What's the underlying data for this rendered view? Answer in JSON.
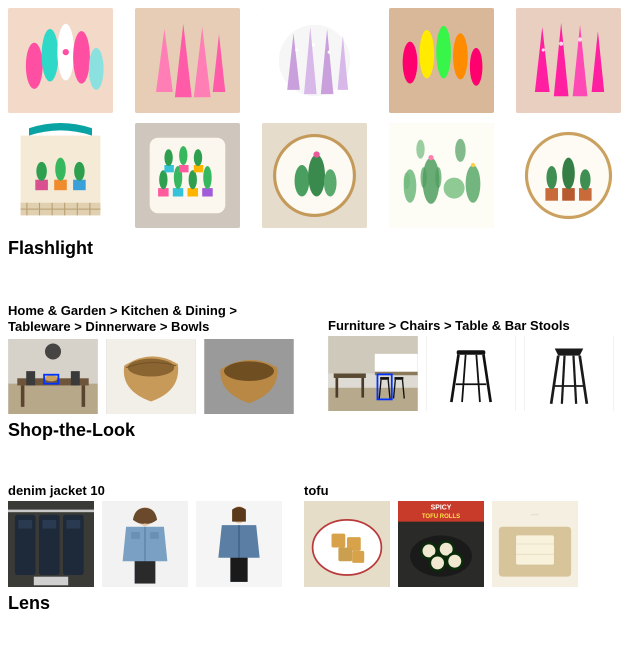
{
  "sections": {
    "flashlight": {
      "heading": "Flashlight",
      "rows": [
        {
          "query_desc": "hand with colorful stiletto nails (pink/teal/art)",
          "results_desc": [
            "pointed pink ombre stiletto nails",
            "glitter chrome stiletto nails",
            "neon multicolor almond nails (pink/yellow/green/orange)",
            "hot pink glitter stiletto nails"
          ]
        },
        {
          "query_desc": "cactus embroidery on jute tote bag",
          "results_desc": [
            "cushion with colorful potted cacti print",
            "embroidery hoop with three green cacti",
            "watercolor cactus illustration set",
            "embroidery hoop with three potted cacti (terracotta pots)"
          ]
        }
      ]
    },
    "shop_the_look": {
      "heading": "Shop-the-Look",
      "groups": [
        {
          "breadcrumb": "Home & Garden > Kitchen & Dining > Tableware > Dinnerware > Bowls",
          "scene_desc": "modern dining room with wood table, bowl highlighted by blue box",
          "results_desc": [
            "carved wooden burl bowl",
            "wooden natural-edge bowl"
          ]
        },
        {
          "breadcrumb": "Furniture > Chairs > Table & Bar Stools",
          "scene_desc": "kitchen counter with black bar stools, stool highlighted by blue box",
          "results_desc": [
            "black metal backless bar stool",
            "black industrial tolix-style bar stool"
          ]
        }
      ]
    },
    "lens": {
      "heading": "Lens",
      "groups": [
        {
          "label": "denim jacket 10",
          "query_desc": "rack of dark denim jackets in store",
          "results_desc": [
            "woman wearing light wash cropped denim jacket",
            "woman wearing medium wash denim jacket, back turned"
          ]
        },
        {
          "label": "tofu",
          "query_desc": "plate of golden fried tofu squares",
          "results_desc": [
            "spicy tofu rolls dish with text overlay SPICY TOFU ROLLS",
            "tofu block on cutting board"
          ]
        }
      ]
    }
  }
}
